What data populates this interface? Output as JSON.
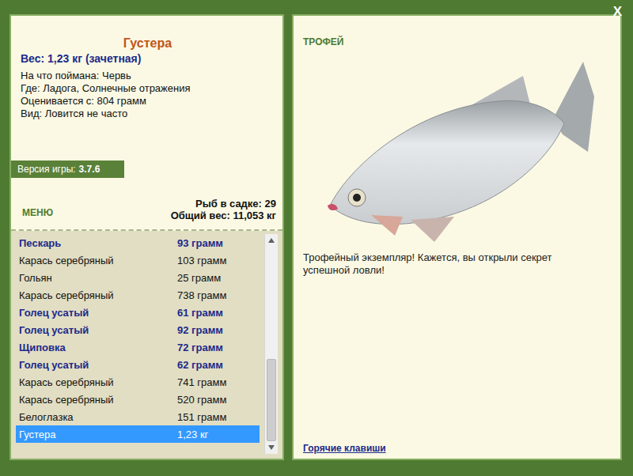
{
  "window": {
    "close": "X"
  },
  "fish": {
    "name": "Густера",
    "weight": "Вес: 1,23 кг (зачетная)",
    "details": [
      "На что поймана: Червь",
      "Где: Ладога, Солнечные отражения",
      "Оценивается с: 804 грамм",
      "Вид: Ловится не часто"
    ]
  },
  "version": {
    "label": "Версия игры:",
    "value": "3.7.6"
  },
  "menu": "МЕНЮ",
  "keepnet": {
    "count": "Рыб в садке: 29",
    "total": "Общий вес: 11,053 кг"
  },
  "catch_list": [
    {
      "name": "Пескарь",
      "weight": "93 грамм",
      "marked": true,
      "selected": false
    },
    {
      "name": "Карась серебряный",
      "weight": "103 грамм",
      "marked": false,
      "selected": false
    },
    {
      "name": "Гольян",
      "weight": "25 грамм",
      "marked": false,
      "selected": false
    },
    {
      "name": "Карась серебряный",
      "weight": "738 грамм",
      "marked": false,
      "selected": false
    },
    {
      "name": "Голец усатый",
      "weight": "61 грамм",
      "marked": true,
      "selected": false
    },
    {
      "name": "Голец усатый",
      "weight": "92 грамм",
      "marked": true,
      "selected": false
    },
    {
      "name": "Щиповка",
      "weight": "72 грамм",
      "marked": true,
      "selected": false
    },
    {
      "name": "Голец усатый",
      "weight": "62 грамм",
      "marked": true,
      "selected": false
    },
    {
      "name": "Карась серебряный",
      "weight": "741 грамм",
      "marked": false,
      "selected": false
    },
    {
      "name": "Карась серебряный",
      "weight": "520 грамм",
      "marked": false,
      "selected": false
    },
    {
      "name": "Белоглазка",
      "weight": "151 грамм",
      "marked": false,
      "selected": false
    },
    {
      "name": "Густера",
      "weight": "1,23 кг",
      "marked": false,
      "selected": true
    }
  ],
  "scrollbar": {
    "level": 0.42,
    "offset": 0.58
  },
  "trophy": {
    "badge": "ТРОФЕЙ",
    "message": "Трофейный экземпляр! Кажется, вы открыли секрет успешной ловли!"
  },
  "hotkeys": "Горячие клавиши"
}
